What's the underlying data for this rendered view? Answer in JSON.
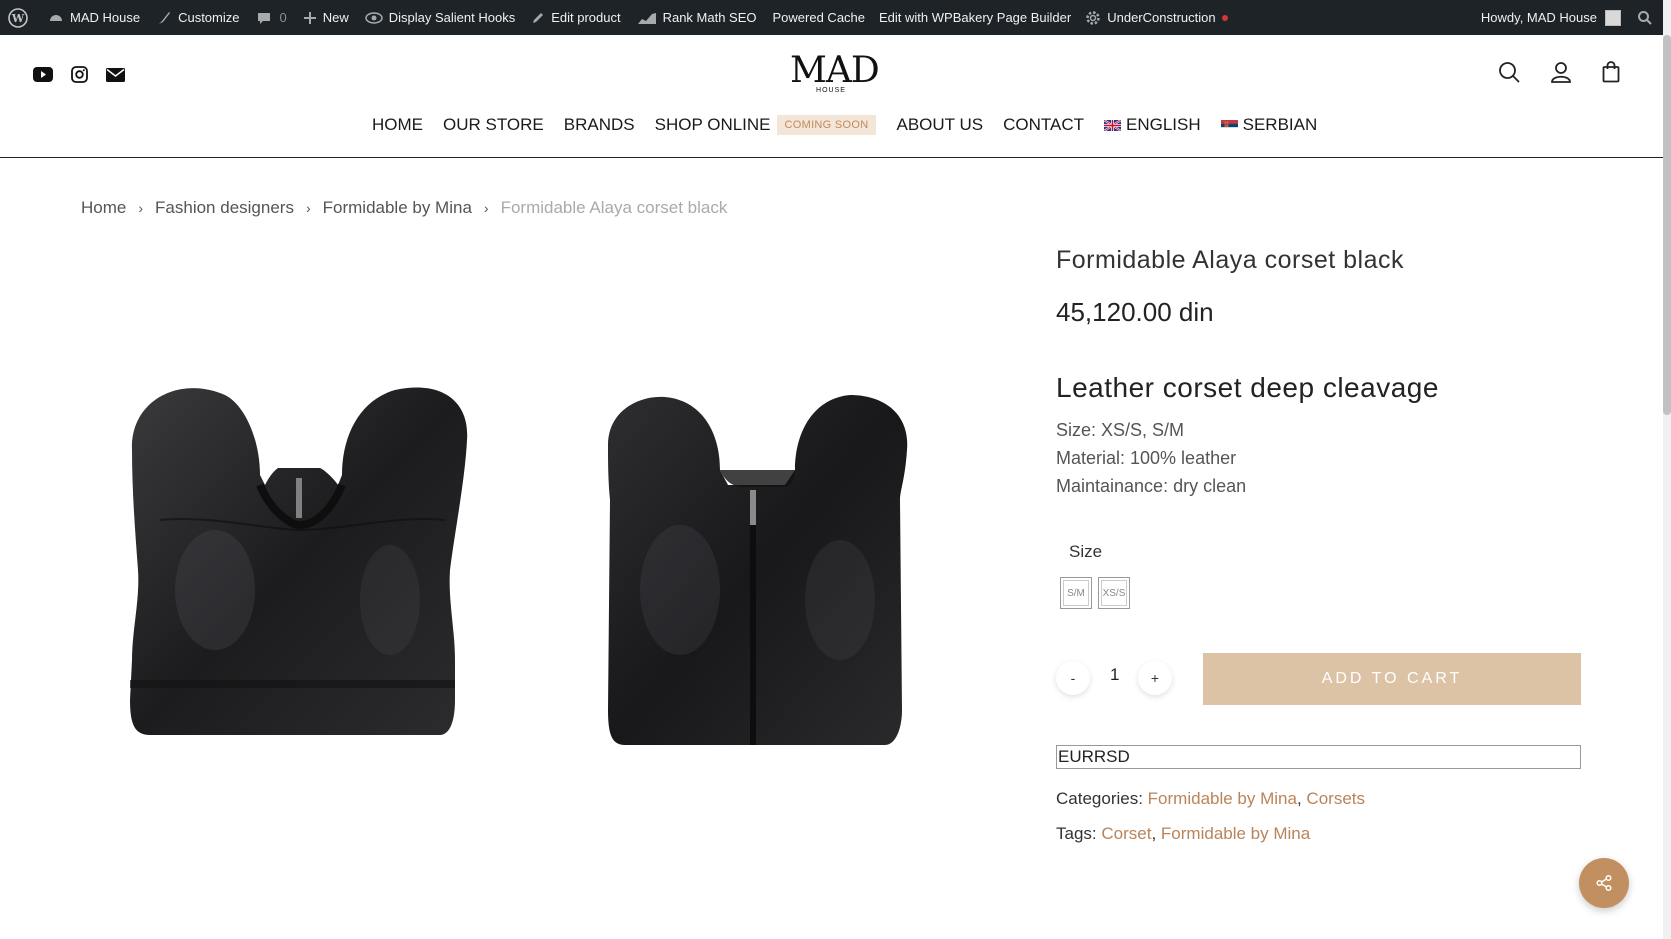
{
  "adminbar": {
    "items": [
      {
        "label": "",
        "icon": "wordpress-icon"
      },
      {
        "label": "MAD House",
        "icon": "dashboard-icon"
      },
      {
        "label": "Customize",
        "icon": "brush-icon"
      },
      {
        "label": "0",
        "icon": "comment-icon"
      },
      {
        "label": "New",
        "icon": "plus-icon"
      },
      {
        "label": "Display Salient Hooks",
        "icon": "eye-icon"
      },
      {
        "label": "Edit product",
        "icon": "pencil-icon"
      },
      {
        "label": "Rank Math SEO",
        "icon": "chart-icon"
      },
      {
        "label": "Powered Cache",
        "icon": ""
      },
      {
        "label": "Edit with WPBakery Page Builder",
        "icon": ""
      },
      {
        "label": "UnderConstruction",
        "icon": "gear-icon"
      }
    ],
    "howdy": "Howdy, MAD House"
  },
  "header": {
    "logo_main": "MAD",
    "logo_sub": "HOUSE",
    "nav": {
      "home": "HOME",
      "store": "OUR STORE",
      "brands": "BRANDS",
      "shop": "SHOP ONLINE",
      "shop_badge": "COMING SOON",
      "about": "ABOUT US",
      "contact": "CONTACT",
      "english": "ENGLISH",
      "serbian": "SERBIAN"
    }
  },
  "breadcrumb": {
    "home": "Home",
    "cat": "Fashion designers",
    "brand": "Formidable by Mina",
    "current": "Formidable Alaya corset black"
  },
  "product": {
    "title": "Formidable Alaya corset black",
    "price": "45,120.00 din",
    "subtitle": "Leather corset deep cleavage",
    "size_line": "Size: XS/S, S/M",
    "material_line": "Material: 100% leather",
    "care_line": "Maintainance: dry clean",
    "size_label": "Size",
    "swatches": [
      "S/M",
      "XS/S"
    ],
    "qty_minus": "-",
    "qty_value": "1",
    "qty_plus": "+",
    "add_to_cart": "ADD TO CART",
    "currency": "EURRSD",
    "categories_label": "Categories:",
    "category_1": "Formidable by Mina",
    "category_2": "Corsets",
    "tags_label": "Tags:",
    "tag_1": "Corset",
    "tag_2": "Formidable by Mina",
    "comma": ","
  },
  "colors": {
    "accent": "#c29060",
    "add_to_cart_bg": "#dcc3a6",
    "link": "#b9845a",
    "adminbar": "#1d2327"
  }
}
